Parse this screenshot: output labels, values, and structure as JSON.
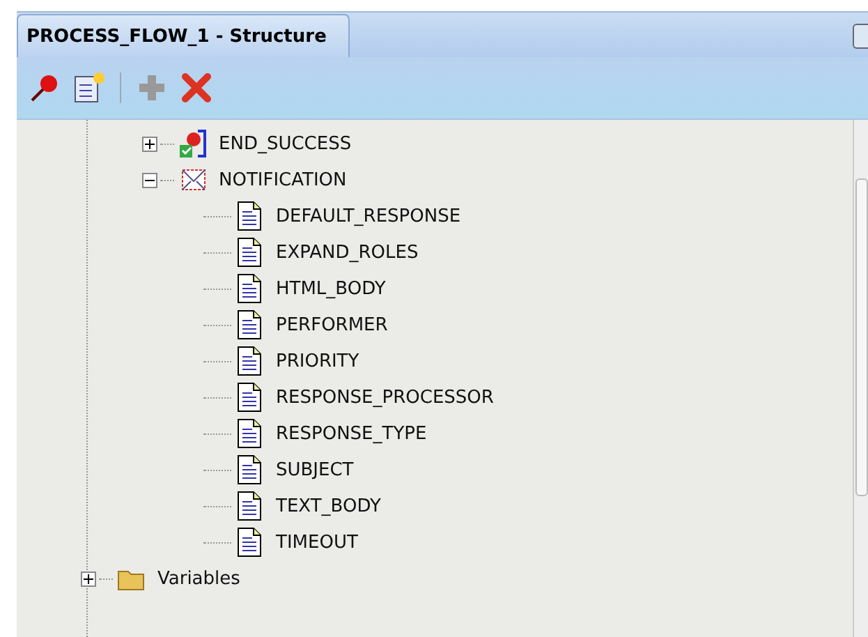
{
  "panel": {
    "title": "PROCESS_FLOW_1 - Structure"
  },
  "toolbar": [
    {
      "kind": "pin"
    },
    {
      "kind": "new"
    },
    {
      "kind": "separator"
    },
    {
      "kind": "add",
      "disabled": true
    },
    {
      "kind": "delete",
      "disabled": false
    }
  ],
  "tree": [
    {
      "label": "END_SUCCESS",
      "kind": "end",
      "expanded": false
    },
    {
      "label": "NOTIFICATION",
      "kind": "notification",
      "expanded": true,
      "children": [
        {
          "label": "DEFAULT_RESPONSE",
          "kind": "attribute"
        },
        {
          "label": "EXPAND_ROLES",
          "kind": "attribute"
        },
        {
          "label": "HTML_BODY",
          "kind": "attribute"
        },
        {
          "label": "PERFORMER",
          "kind": "attribute"
        },
        {
          "label": "PRIORITY",
          "kind": "attribute"
        },
        {
          "label": "RESPONSE_PROCESSOR",
          "kind": "attribute"
        },
        {
          "label": "RESPONSE_TYPE",
          "kind": "attribute"
        },
        {
          "label": "SUBJECT",
          "kind": "attribute"
        },
        {
          "label": "TEXT_BODY",
          "kind": "attribute"
        },
        {
          "label": "TIMEOUT",
          "kind": "attribute"
        }
      ]
    },
    {
      "label": "Variables",
      "kind": "folder",
      "expanded": false,
      "outdent": true
    }
  ]
}
